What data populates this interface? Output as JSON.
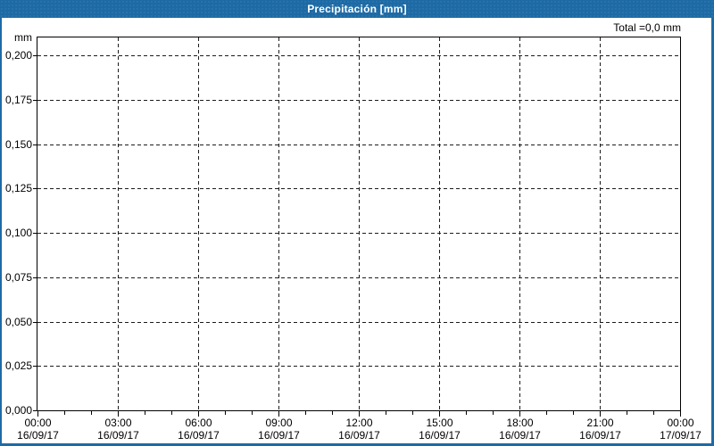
{
  "title_bar": {
    "title": "Precipitación [mm]",
    "bg_color": "#1d6aa5",
    "text_color": "#ffffff"
  },
  "total_label": "Total =0,0 mm",
  "y_axis": {
    "unit_label": "mm",
    "tick_labels": [
      "0,200",
      "0,175",
      "0,150",
      "0,125",
      "0,100",
      "0,075",
      "0,050",
      "0,025",
      "0,000"
    ]
  },
  "x_axis": {
    "tick_labels": [
      {
        "time": "00:00",
        "date": "16/09/17"
      },
      {
        "time": "03:00",
        "date": "16/09/17"
      },
      {
        "time": "06:00",
        "date": "16/09/17"
      },
      {
        "time": "09:00",
        "date": "16/09/17"
      },
      {
        "time": "12:00",
        "date": "16/09/17"
      },
      {
        "time": "15:00",
        "date": "16/09/17"
      },
      {
        "time": "18:00",
        "date": "16/09/17"
      },
      {
        "time": "21:00",
        "date": "16/09/17"
      },
      {
        "time": "00:00",
        "date": "17/09/17"
      }
    ]
  },
  "chart_data": {
    "type": "line",
    "title": "Precipitación [mm]",
    "ylabel": "mm",
    "ylim": [
      0,
      0.21
    ],
    "y_ticks": [
      0.0,
      0.025,
      0.05,
      0.075,
      0.1,
      0.125,
      0.15,
      0.175,
      0.2
    ],
    "y_tick_step": 0.025,
    "x_range_hours": [
      0,
      24
    ],
    "x_major_tick_hours": 3,
    "x_minor_tick_hours": 1,
    "x_tick_times": [
      "00:00",
      "03:00",
      "06:00",
      "09:00",
      "12:00",
      "15:00",
      "18:00",
      "21:00",
      "00:00"
    ],
    "x_tick_dates": [
      "16/09/17",
      "16/09/17",
      "16/09/17",
      "16/09/17",
      "16/09/17",
      "16/09/17",
      "16/09/17",
      "16/09/17",
      "17/09/17"
    ],
    "grid": "dashed",
    "legend": "none",
    "series": [
      {
        "name": "Precipitación",
        "values": [],
        "note": "no precipitation recorded; plot area empty"
      }
    ],
    "total_mm": 0.0,
    "total_text": "Total =0,0 mm"
  }
}
